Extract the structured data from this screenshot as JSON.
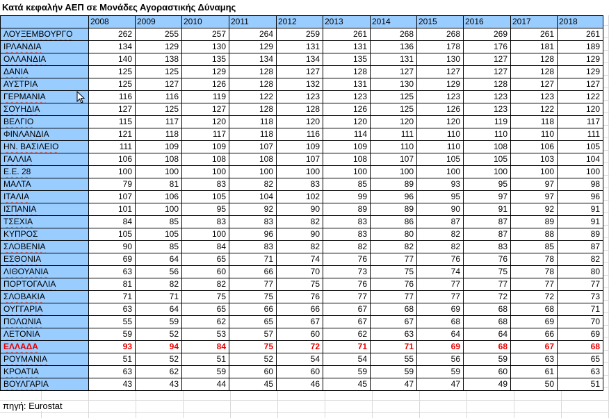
{
  "title": "Κατά κεφαλήν ΑΕΠ σε Μονάδες Αγοραστικής Δύναμης",
  "years": [
    "2008",
    "2009",
    "2010",
    "2011",
    "2012",
    "2013",
    "2014",
    "2015",
    "2016",
    "2017",
    "2018"
  ],
  "rows": [
    {
      "country": "ΛΟΥΞΕΜΒΟΥΡΓΟ",
      "values": [
        "262",
        "255",
        "257",
        "264",
        "259",
        "261",
        "268",
        "268",
        "269",
        "261",
        "261"
      ]
    },
    {
      "country": "ΙΡΛΑΝΔΙΑ",
      "values": [
        "134",
        "129",
        "130",
        "129",
        "131",
        "131",
        "136",
        "178",
        "176",
        "181",
        "189"
      ]
    },
    {
      "country": "ΟΛΛΑΝΔΙΑ",
      "values": [
        "140",
        "138",
        "135",
        "134",
        "134",
        "135",
        "131",
        "130",
        "127",
        "128",
        "129"
      ]
    },
    {
      "country": "ΔΑΝΙΑ",
      "values": [
        "125",
        "125",
        "129",
        "128",
        "127",
        "128",
        "127",
        "127",
        "127",
        "128",
        "129"
      ]
    },
    {
      "country": "ΑΥΣΤΡΙΑ",
      "values": [
        "125",
        "127",
        "126",
        "128",
        "132",
        "131",
        "130",
        "129",
        "128",
        "127",
        "127"
      ]
    },
    {
      "country": "ΓΕΡΜΑΝΙΑ",
      "values": [
        "116",
        "116",
        "119",
        "122",
        "123",
        "123",
        "125",
        "123",
        "123",
        "123",
        "122"
      ]
    },
    {
      "country": "ΣΟΥΗΔΙΑ",
      "values": [
        "127",
        "125",
        "127",
        "128",
        "128",
        "126",
        "125",
        "126",
        "123",
        "122",
        "120"
      ]
    },
    {
      "country": "ΒΕΛΓΙΟ",
      "values": [
        "115",
        "117",
        "120",
        "118",
        "120",
        "120",
        "120",
        "120",
        "119",
        "118",
        "117"
      ]
    },
    {
      "country": "ΦΙΝΛΑΝΔΙΑ",
      "values": [
        "121",
        "118",
        "117",
        "118",
        "116",
        "114",
        "111",
        "110",
        "110",
        "110",
        "111"
      ]
    },
    {
      "country": "ΗΝ. ΒΑΣΙΛΕΙΟ",
      "values": [
        "111",
        "109",
        "109",
        "107",
        "109",
        "109",
        "110",
        "110",
        "108",
        "106",
        "105"
      ]
    },
    {
      "country": "ΓΑΛΛΙΑ",
      "values": [
        "106",
        "108",
        "108",
        "108",
        "107",
        "108",
        "107",
        "105",
        "105",
        "103",
        "104"
      ]
    },
    {
      "country": "Ε.Ε. 28",
      "values": [
        "100",
        "100",
        "100",
        "100",
        "100",
        "100",
        "100",
        "100",
        "100",
        "100",
        "100"
      ]
    },
    {
      "country": "ΜΑΛΤΑ",
      "values": [
        "79",
        "81",
        "83",
        "82",
        "83",
        "85",
        "89",
        "93",
        "95",
        "97",
        "98"
      ]
    },
    {
      "country": "ΙΤΑΛΙΑ",
      "values": [
        "107",
        "106",
        "105",
        "104",
        "102",
        "99",
        "96",
        "95",
        "97",
        "97",
        "96"
      ]
    },
    {
      "country": "ΙΣΠΑΝΙΑ",
      "values": [
        "101",
        "100",
        "95",
        "92",
        "90",
        "89",
        "89",
        "90",
        "91",
        "92",
        "91"
      ]
    },
    {
      "country": "ΤΣΕΧΙΑ",
      "values": [
        "84",
        "85",
        "83",
        "83",
        "82",
        "83",
        "86",
        "87",
        "87",
        "89",
        "91"
      ]
    },
    {
      "country": "ΚΥΠΡΟΣ",
      "values": [
        "105",
        "105",
        "100",
        "96",
        "90",
        "83",
        "80",
        "82",
        "87",
        "88",
        "89"
      ]
    },
    {
      "country": "ΣΛΟΒΕΝΙΑ",
      "values": [
        "90",
        "85",
        "84",
        "83",
        "82",
        "82",
        "82",
        "82",
        "83",
        "85",
        "87"
      ]
    },
    {
      "country": "ΕΣΘΟΝΙΑ",
      "values": [
        "69",
        "64",
        "65",
        "71",
        "74",
        "76",
        "77",
        "76",
        "76",
        "78",
        "82"
      ]
    },
    {
      "country": "ΛΙΘΟΥΑΝΙΑ",
      "values": [
        "63",
        "56",
        "60",
        "66",
        "70",
        "73",
        "75",
        "74",
        "75",
        "78",
        "80"
      ]
    },
    {
      "country": "ΠΟΡΤΟΓΑΛΙΑ",
      "values": [
        "81",
        "82",
        "82",
        "77",
        "75",
        "76",
        "76",
        "77",
        "77",
        "77",
        "77"
      ]
    },
    {
      "country": "ΣΛΟΒΑΚΙΑ",
      "values": [
        "71",
        "71",
        "75",
        "75",
        "76",
        "77",
        "77",
        "77",
        "72",
        "72",
        "73"
      ]
    },
    {
      "country": "ΟΥΓΓΑΡΙΑ",
      "values": [
        "63",
        "64",
        "65",
        "66",
        "66",
        "67",
        "68",
        "69",
        "68",
        "68",
        "71"
      ]
    },
    {
      "country": "ΠΟΛΩΝΙΑ",
      "values": [
        "55",
        "59",
        "62",
        "65",
        "67",
        "67",
        "67",
        "68",
        "68",
        "69",
        "70"
      ]
    },
    {
      "country": "ΛΕΤΟΝΙΑ",
      "values": [
        "59",
        "52",
        "53",
        "57",
        "60",
        "62",
        "63",
        "64",
        "64",
        "66",
        "69"
      ]
    },
    {
      "country": "ΕΛΛΑΔΑ",
      "values": [
        "93",
        "94",
        "84",
        "75",
        "72",
        "71",
        "71",
        "69",
        "68",
        "67",
        "68"
      ],
      "highlight": true
    },
    {
      "country": "ΡΟΥΜΑΝΙΑ",
      "values": [
        "51",
        "52",
        "51",
        "52",
        "54",
        "54",
        "55",
        "56",
        "59",
        "63",
        "65"
      ]
    },
    {
      "country": "ΚΡΟΑΤΙΑ",
      "values": [
        "63",
        "62",
        "59",
        "60",
        "60",
        "59",
        "59",
        "59",
        "60",
        "61",
        "63"
      ]
    },
    {
      "country": "ΒΟΥΛΓΑΡΙΑ",
      "values": [
        "43",
        "43",
        "44",
        "45",
        "46",
        "45",
        "47",
        "47",
        "49",
        "50",
        "51"
      ]
    }
  ],
  "source": "πηγή: Eurostat",
  "colors": {
    "header_fill": "#99ccff",
    "highlight_text": "#e60000",
    "spell_underline": "#e06666"
  },
  "icons": {
    "cursor": "mouse-pointer-icon"
  }
}
